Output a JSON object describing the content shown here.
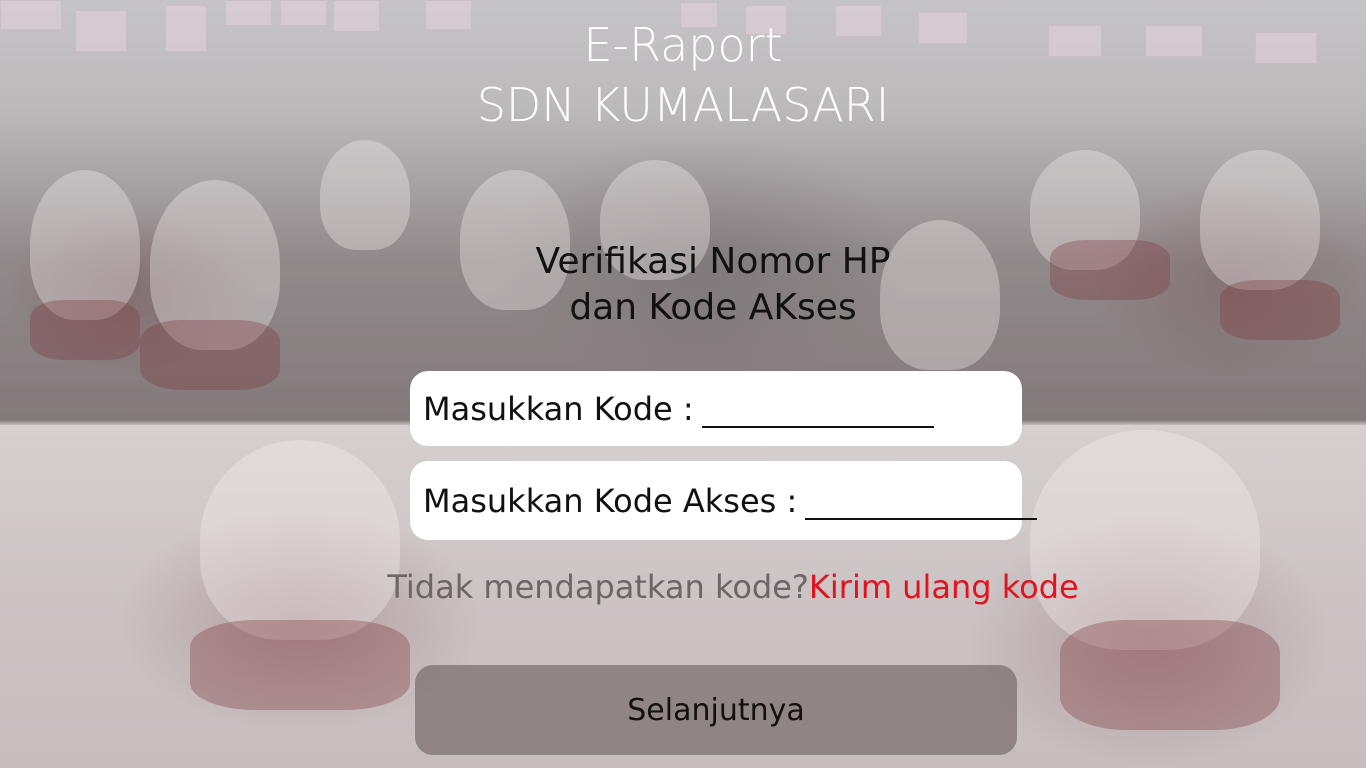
{
  "app": {
    "title_line1": "E-Raport",
    "title_line2": "SDN KUMALASARI"
  },
  "verification": {
    "heading_line1": "Verifikasi Nomor HP",
    "heading_line2": "dan Kode AKses"
  },
  "form": {
    "code_label": "Masukkan Kode :",
    "code_value": "",
    "access_label": "Masukkan Kode Akses :",
    "access_value": ""
  },
  "resend": {
    "question": "Tidak mendapatkan kode?",
    "link_label": "Kirim ulang kode"
  },
  "actions": {
    "next_label": "Selanjutnya"
  },
  "colors": {
    "title": "#ffffff",
    "resend_link": "#e0141e",
    "button_bg": "#6e5f5f"
  }
}
